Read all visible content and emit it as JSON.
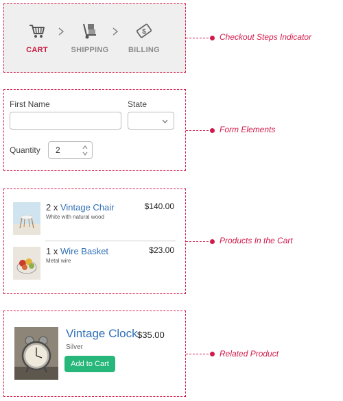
{
  "steps": {
    "items": [
      {
        "label": "CART",
        "icon": "cart-icon",
        "active": true
      },
      {
        "label": "SHIPPING",
        "icon": "hand-truck-icon",
        "active": false
      },
      {
        "label": "BILLING",
        "icon": "dollar-card-icon",
        "active": false
      }
    ],
    "callout": "Checkout Steps Indicator"
  },
  "form": {
    "first_name_label": "First Name",
    "first_name_value": "",
    "state_label": "State",
    "state_value": "",
    "quantity_label": "Quantity",
    "quantity_value": "2",
    "callout": "Form Elements"
  },
  "cart": {
    "items": [
      {
        "qty": "2 x",
        "name": "Vintage Chair",
        "desc": "White with natural wood",
        "price": "$140.00"
      },
      {
        "qty": "1 x",
        "name": "Wire Basket",
        "desc": "Metal wire",
        "price": "$23.00"
      }
    ],
    "callout": "Products In the Cart"
  },
  "related": {
    "name": "Vintage Clock",
    "price": "$35.00",
    "desc": "Silver",
    "button_label": "Add to Cart",
    "callout": "Related Product"
  },
  "colors": {
    "accent": "#d11a4a",
    "link": "#2f6fb6",
    "button": "#27b77a",
    "inactive_step": "#8a8a8a"
  }
}
